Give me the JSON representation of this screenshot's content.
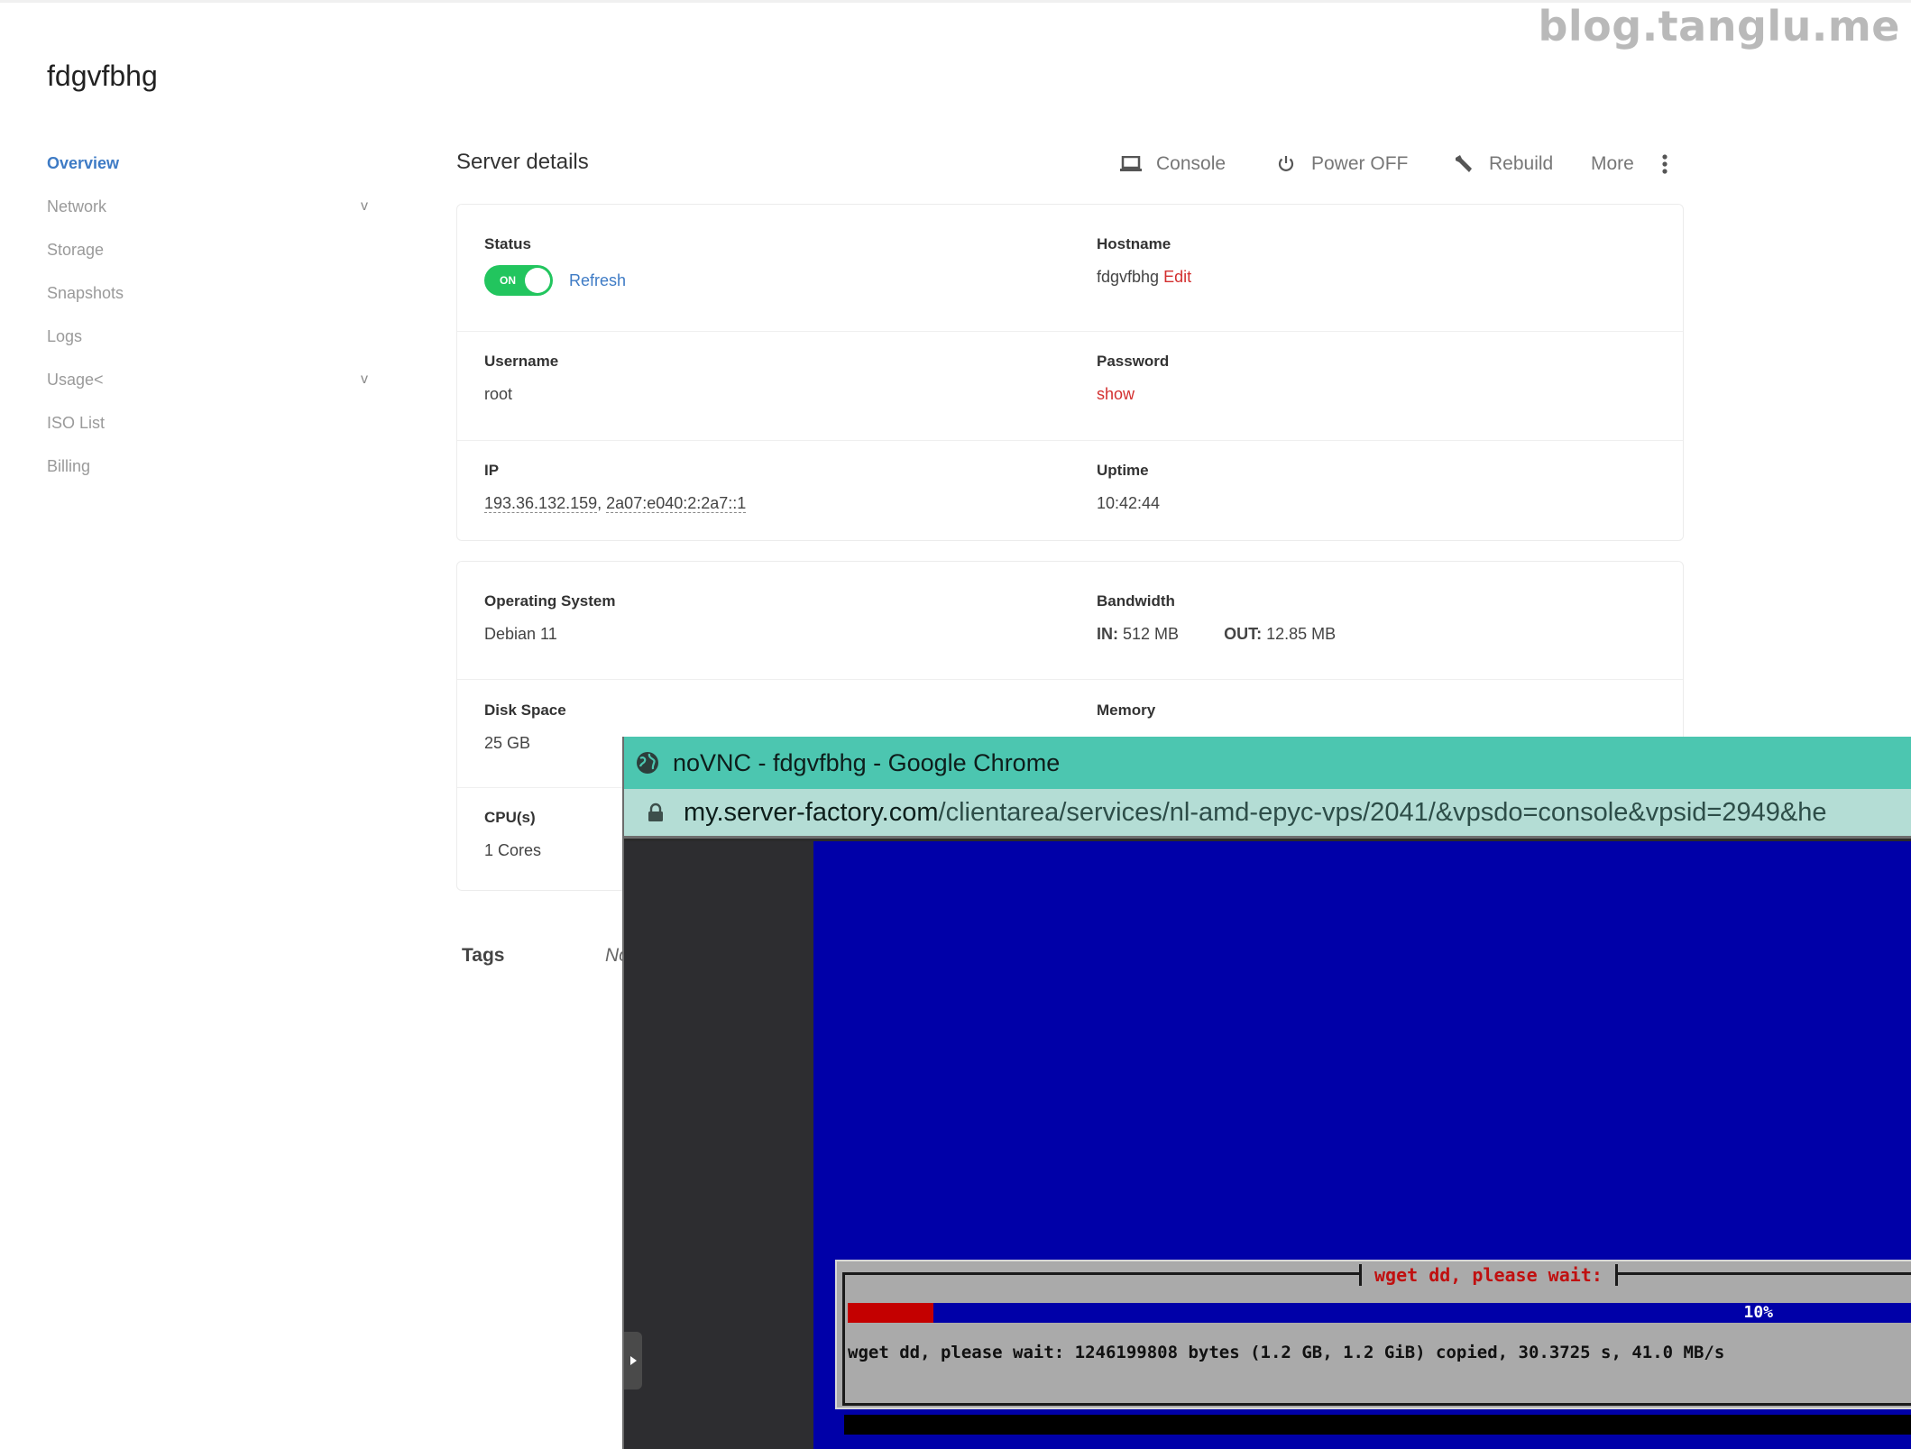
{
  "watermark": "blog.tanglu.me",
  "server": {
    "name": "fdgvfbhg"
  },
  "sidebar": {
    "items": [
      {
        "label": "Overview",
        "active": true,
        "chevron": false
      },
      {
        "label": "Network",
        "active": false,
        "chevron": true
      },
      {
        "label": "Storage",
        "active": false,
        "chevron": false
      },
      {
        "label": "Snapshots",
        "active": false,
        "chevron": false
      },
      {
        "label": "Logs",
        "active": false,
        "chevron": false
      },
      {
        "label": "Usage<",
        "active": false,
        "chevron": true
      },
      {
        "label": "ISO List",
        "active": false,
        "chevron": false
      },
      {
        "label": "Billing",
        "active": false,
        "chevron": false
      }
    ],
    "chevron_glyph": "v"
  },
  "header": {
    "title": "Server details",
    "actions": [
      {
        "label": "Console",
        "icon": "laptop-icon"
      },
      {
        "label": "Power OFF",
        "icon": "power-icon"
      },
      {
        "label": "Rebuild",
        "icon": "wrench-icon"
      },
      {
        "label": "More",
        "icon": "kebab-icon"
      }
    ]
  },
  "details": {
    "status": {
      "label": "Status",
      "toggle_text": "ON",
      "toggle_on": true,
      "refresh": "Refresh"
    },
    "hostname": {
      "label": "Hostname",
      "value": "fdgvfbhg",
      "edit": "Edit"
    },
    "username": {
      "label": "Username",
      "value": "root"
    },
    "password": {
      "label": "Password",
      "action": "show"
    },
    "ip": {
      "label": "IP",
      "ipv4": "193.36.132.159",
      "separator": ",",
      "ipv6": "2a07:e040:2:2a7::1"
    },
    "uptime": {
      "label": "Uptime",
      "value": "10:42:44"
    }
  },
  "specs": {
    "os": {
      "label": "Operating System",
      "value": "Debian 11"
    },
    "bandwidth": {
      "label": "Bandwidth",
      "in_label": "IN:",
      "in_value": "512 MB",
      "out_label": "OUT:",
      "out_value": "12.85 MB"
    },
    "disk": {
      "label": "Disk Space",
      "value": "25 GB"
    },
    "memory": {
      "label": "Memory"
    },
    "cpu": {
      "label": "CPU(s)",
      "value": "1 Cores"
    }
  },
  "tags": {
    "label": "Tags",
    "value": "No"
  },
  "popup": {
    "window_title": "noVNC - fdgvfbhg - Google Chrome",
    "url_domain": "my.server-factory.com",
    "url_path": "/clientarea/services/nl-amd-epyc-vps/2041/&vpsdo=console&vpsid=2949&he",
    "console": {
      "dialog_title": "wget dd, please wait:",
      "progress_fraction": 0.1,
      "progress_text": "10%",
      "message": "wget dd, please wait: 1246199808 bytes (1.2 GB, 1.2 GiB) copied, 30.3725 s, 41.0 MB/s"
    }
  },
  "colors": {
    "accent_blue": "#3e7bc5",
    "toggle_green": "#22c55e",
    "link_red": "#d32f2f",
    "chrome_titlebar": "#4cc6b0",
    "vnc_blue": "#0000a8",
    "progress_red": "#c40000"
  }
}
